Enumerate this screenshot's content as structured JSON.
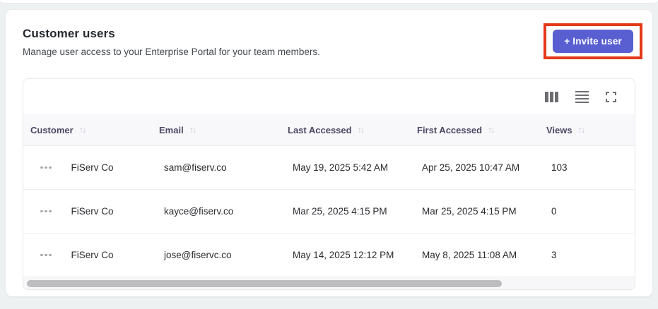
{
  "colors": {
    "accent": "#595fd1",
    "highlight_red": "#e53817",
    "header_row_bg": "#f8f8fb"
  },
  "header": {
    "title": "Customer users",
    "subtitle": "Manage user access to your Enterprise Portal for your team members.",
    "invite_button_label": "+ Invite user"
  },
  "toolbar": {
    "icons": [
      "columns-icon",
      "row-density-icon",
      "fullscreen-icon"
    ]
  },
  "table": {
    "sort_glyph": "↑↓",
    "columns": [
      {
        "label": "Customer",
        "sortable": true
      },
      {
        "label": "Email",
        "sortable": true
      },
      {
        "label": "Last Accessed",
        "sortable": true
      },
      {
        "label": "First Accessed",
        "sortable": true
      },
      {
        "label": "Views",
        "sortable": true
      }
    ],
    "rows": [
      {
        "customer": "FiServ Co",
        "email": "sam@fiserv.co",
        "last_accessed": "May 19, 2025 5:42 AM",
        "first_accessed": "Apr 25, 2025 10:47 AM",
        "views": "103"
      },
      {
        "customer": "FiServ Co",
        "email": "kayce@fiserv.co",
        "last_accessed": "Mar 25, 2025 4:15 PM",
        "first_accessed": "Mar 25, 2025 4:15 PM",
        "views": "0"
      },
      {
        "customer": "FiServ Co",
        "email": "jose@fiservc.co",
        "last_accessed": "May 14, 2025 12:12 PM",
        "first_accessed": "May 8, 2025 11:08 AM",
        "views": "3"
      }
    ]
  }
}
